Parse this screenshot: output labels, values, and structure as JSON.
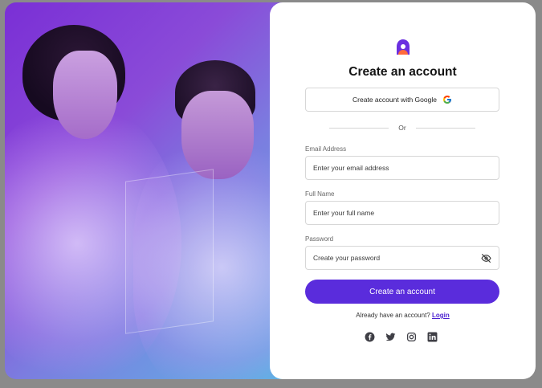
{
  "form": {
    "title": "Create an account",
    "google_button": "Create account with Google",
    "divider": "Or",
    "email": {
      "label": "Email Address",
      "placeholder": "Enter your email address",
      "value": ""
    },
    "full_name": {
      "label": "Full Name",
      "placeholder": "Enter your full name",
      "value": ""
    },
    "password": {
      "label": "Password",
      "placeholder": "Create your password",
      "value": ""
    },
    "submit_button": "Create an account",
    "login_prompt": "Already have an account?",
    "login_link": "Login"
  },
  "social_icons": [
    "facebook-icon",
    "twitter-icon",
    "instagram-icon",
    "linkedin-icon"
  ],
  "colors": {
    "accent": "#5a2cdc",
    "link": "#4a1fd0",
    "logo_top": "#6a2fe0",
    "logo_bottom": "#ff6a3d"
  }
}
